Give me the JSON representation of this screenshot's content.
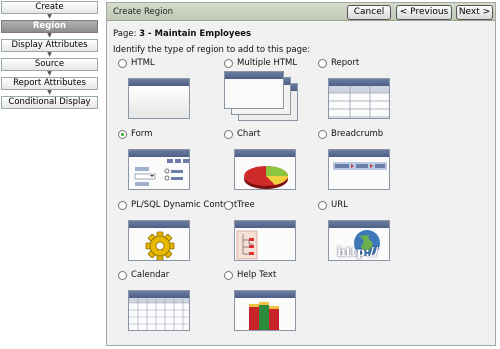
{
  "wizard": {
    "steps": [
      "Create",
      "Region",
      "Display Attributes",
      "Source",
      "Report Attributes",
      "Conditional Display"
    ],
    "active_step": "Region"
  },
  "panel": {
    "title": "Create Region",
    "cancel_label": "Cancel",
    "previous_label": "< Previous",
    "next_label": "Next >",
    "page_prefix": "Page:",
    "page_value": "3 - Maintain Employees",
    "instruction": "Identify the type of region to add to this page:"
  },
  "region_types": [
    {
      "label": "HTML",
      "icon": "html-region-icon",
      "selected": false
    },
    {
      "label": "Multiple HTML",
      "icon": "multiple-html-region-icon",
      "selected": false
    },
    {
      "label": "Report",
      "icon": "report-region-icon",
      "selected": false
    },
    {
      "label": "Form",
      "icon": "form-region-icon",
      "selected": true
    },
    {
      "label": "Chart",
      "icon": "chart-region-icon",
      "selected": false
    },
    {
      "label": "Breadcrumb",
      "icon": "breadcrumb-region-icon",
      "selected": false
    },
    {
      "label": "PL/SQL Dynamic Content",
      "icon": "plsql-gear-icon",
      "selected": false
    },
    {
      "label": "Tree",
      "icon": "tree-region-icon",
      "selected": false
    },
    {
      "label": "URL",
      "icon": "url-globe-icon",
      "selected": false
    },
    {
      "label": "Calendar",
      "icon": "calendar-region-icon",
      "selected": false
    },
    {
      "label": "Help Text",
      "icon": "help-text-books-icon",
      "selected": false
    }
  ],
  "url_icon_text": "http://"
}
